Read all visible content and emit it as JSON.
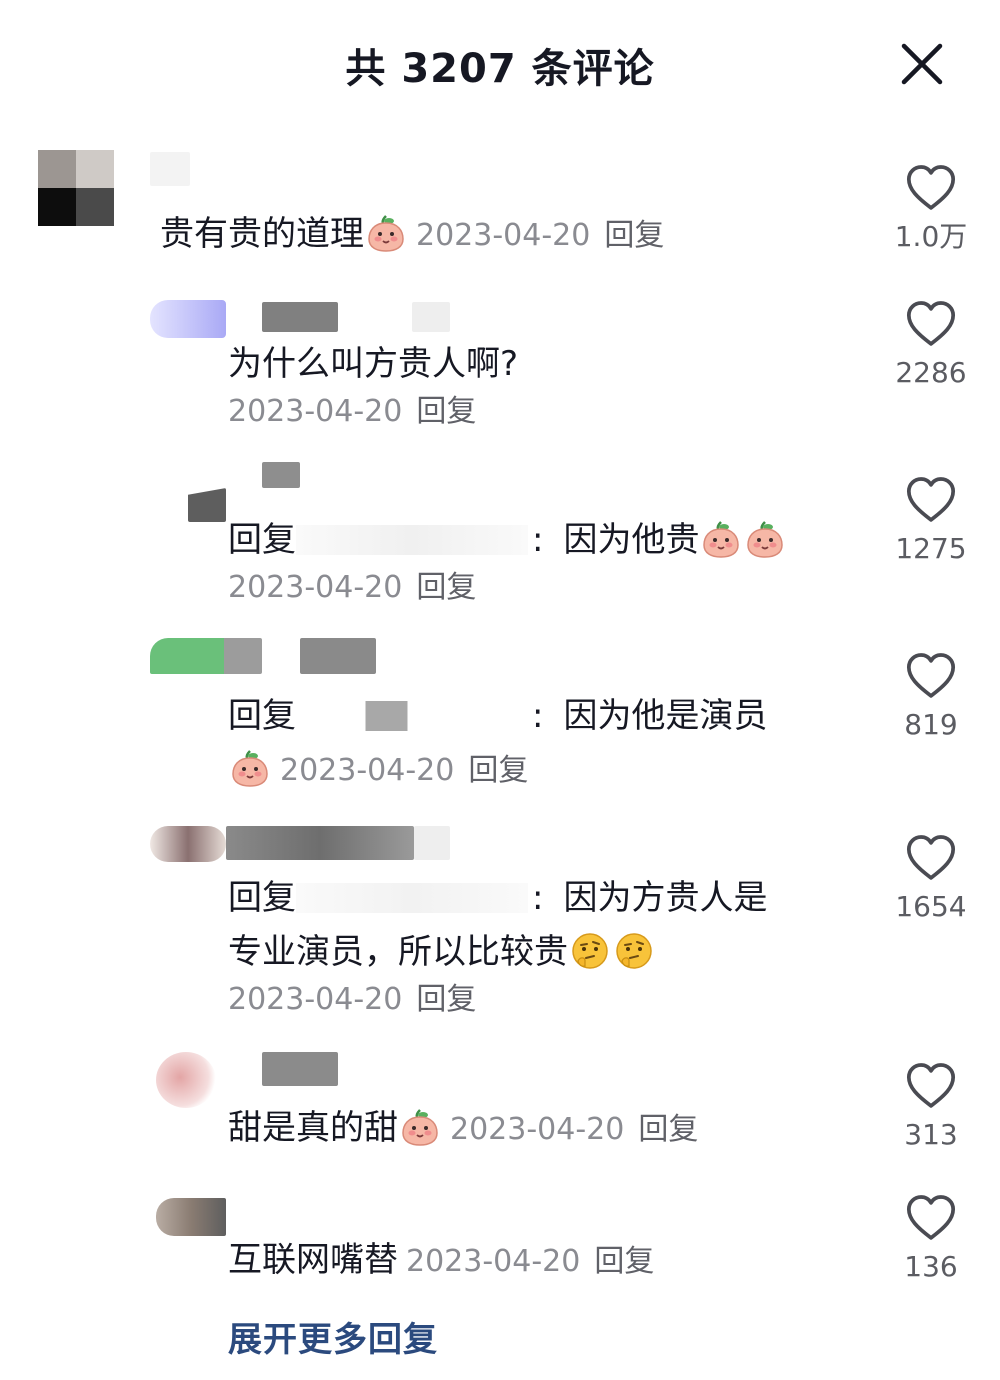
{
  "header": {
    "title": "共 3207 条评论"
  },
  "comment": {
    "text": "贵有贵的道理",
    "date": "2023-04-20",
    "reply_label": "回复",
    "likes": "1.0万"
  },
  "replies": [
    {
      "text": "为什么叫方贵人啊?",
      "date": "2023-04-20",
      "reply_label": "回复",
      "likes": "2286"
    },
    {
      "prefix": "回复",
      "colon": ":",
      "text": "因为他贵",
      "date": "2023-04-20",
      "reply_label": "回复",
      "likes": "1275"
    },
    {
      "prefix": "回复",
      "colon": ":",
      "text": "因为他是演员",
      "date": "2023-04-20",
      "reply_label": "回复",
      "likes": "819"
    },
    {
      "prefix": "回复",
      "colon": ":",
      "text": "因为方贵人是",
      "text2": "专业演员，所以比较贵",
      "date": "2023-04-20",
      "reply_label": "回复",
      "likes": "1654"
    },
    {
      "text": "甜是真的甜",
      "date": "2023-04-20",
      "reply_label": "回复",
      "likes": "313"
    },
    {
      "text": "互联网嘴替",
      "date": "2023-04-20",
      "reply_label": "回复",
      "likes": "136"
    }
  ],
  "more_replies": "展开更多回复",
  "icons": {
    "close": "close-icon",
    "like": "heart-outline-icon",
    "emoji_peach": "peach-face-emoji",
    "emoji_thinking": "thinking-face-emoji"
  },
  "colors": {
    "link": "#2b4a7e",
    "muted": "#8a8b91",
    "text": "#161823"
  }
}
